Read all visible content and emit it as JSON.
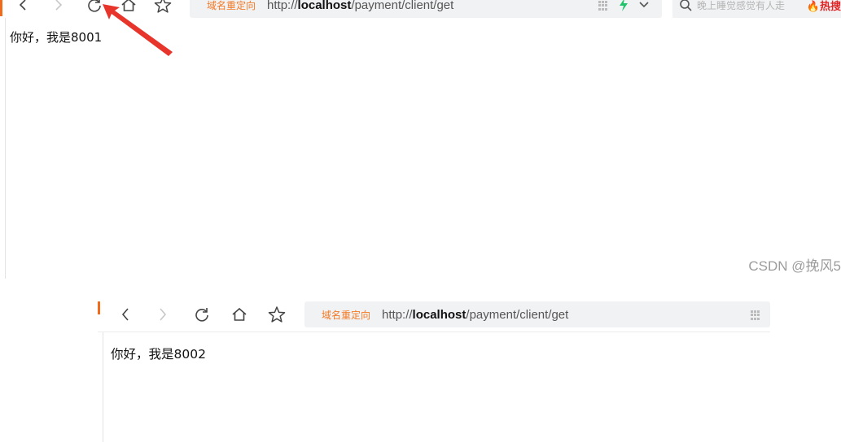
{
  "top_browser": {
    "redirect_label": "域名重定向",
    "url_prefix": "http://",
    "url_host": "localhost",
    "url_path": "/payment/client/get",
    "search_placeholder": "晚上睡觉感觉有人走",
    "hot_label": "热搜",
    "page_text": "你好，我是8001"
  },
  "bottom_browser": {
    "redirect_label": "域名重定向",
    "url_prefix": "http://",
    "url_host": "localhost",
    "url_path": "/payment/client/get",
    "page_text": "你好，我是8002"
  },
  "watermark": "CSDN @挽风5",
  "colors": {
    "accent_orange": "#f27a26",
    "arrow_red": "#e8352b",
    "hot_red": "#e02525",
    "bolt_green": "#21c46a"
  },
  "icons": [
    "back-icon",
    "forward-icon",
    "refresh-icon",
    "home-icon",
    "star-icon",
    "qr-code-icon",
    "bolt-icon",
    "chevron-down-icon",
    "search-icon",
    "fire-icon"
  ]
}
